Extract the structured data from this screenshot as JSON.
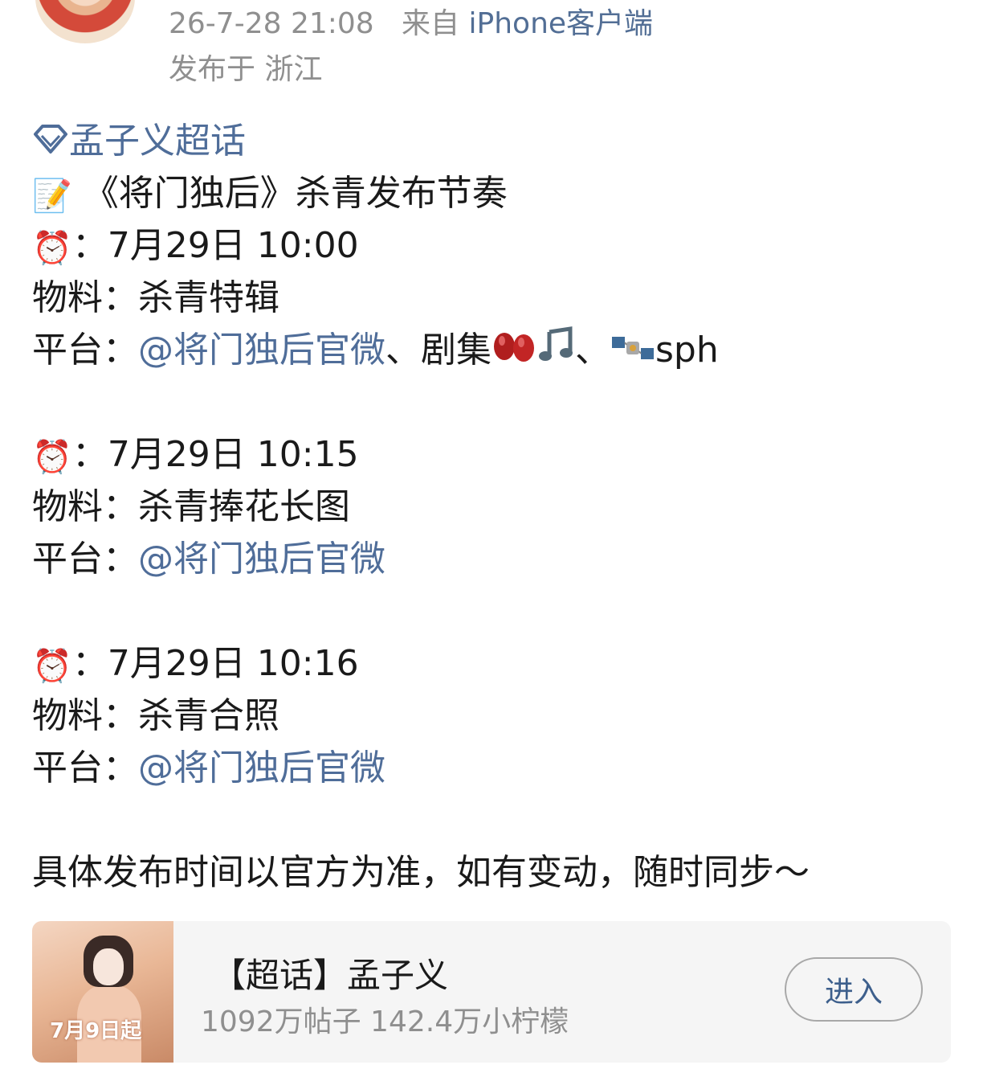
{
  "header": {
    "timestamp": "26-7-28 21:08",
    "from_label": "来自",
    "client": "iPhone客户端",
    "location": "发布于 浙江"
  },
  "post": {
    "topic": "孟子义超话",
    "title": "《将门独后》杀青发布节奏",
    "colon": "：",
    "material_label": "物料：",
    "platform_label": "平台：",
    "schedule": [
      {
        "time": "7月29日 10:00",
        "material": "杀青特辑",
        "platform_link": "@将门独后官微",
        "platform_extra_1": "、剧集",
        "platform_extra_2": "、",
        "platform_extra_3": "sph"
      },
      {
        "time": "7月29日 10:15",
        "material": "杀青捧花长图",
        "platform_link": "@将门独后官微"
      },
      {
        "time": "7月29日 10:16",
        "material": "杀青合照",
        "platform_link": "@将门独后官微"
      }
    ],
    "footer": "具体发布时间以官方为准，如有变动，随时同步～"
  },
  "icons": {
    "topic": "diamond-icon",
    "title": "memo-icon",
    "time": "alarm-clock-icon",
    "platforms": [
      "beans-icon",
      "music-note-icon",
      "satellite-icon"
    ]
  },
  "card": {
    "poster_text": "7月9日起",
    "title": "【超话】孟子义",
    "stats": "1092万帖子 142.4万小柠檬",
    "enter_label": "进入"
  },
  "colors": {
    "link": "#4f6d99",
    "meta": "#8f8f8f",
    "card_bg": "#f5f5f5"
  }
}
